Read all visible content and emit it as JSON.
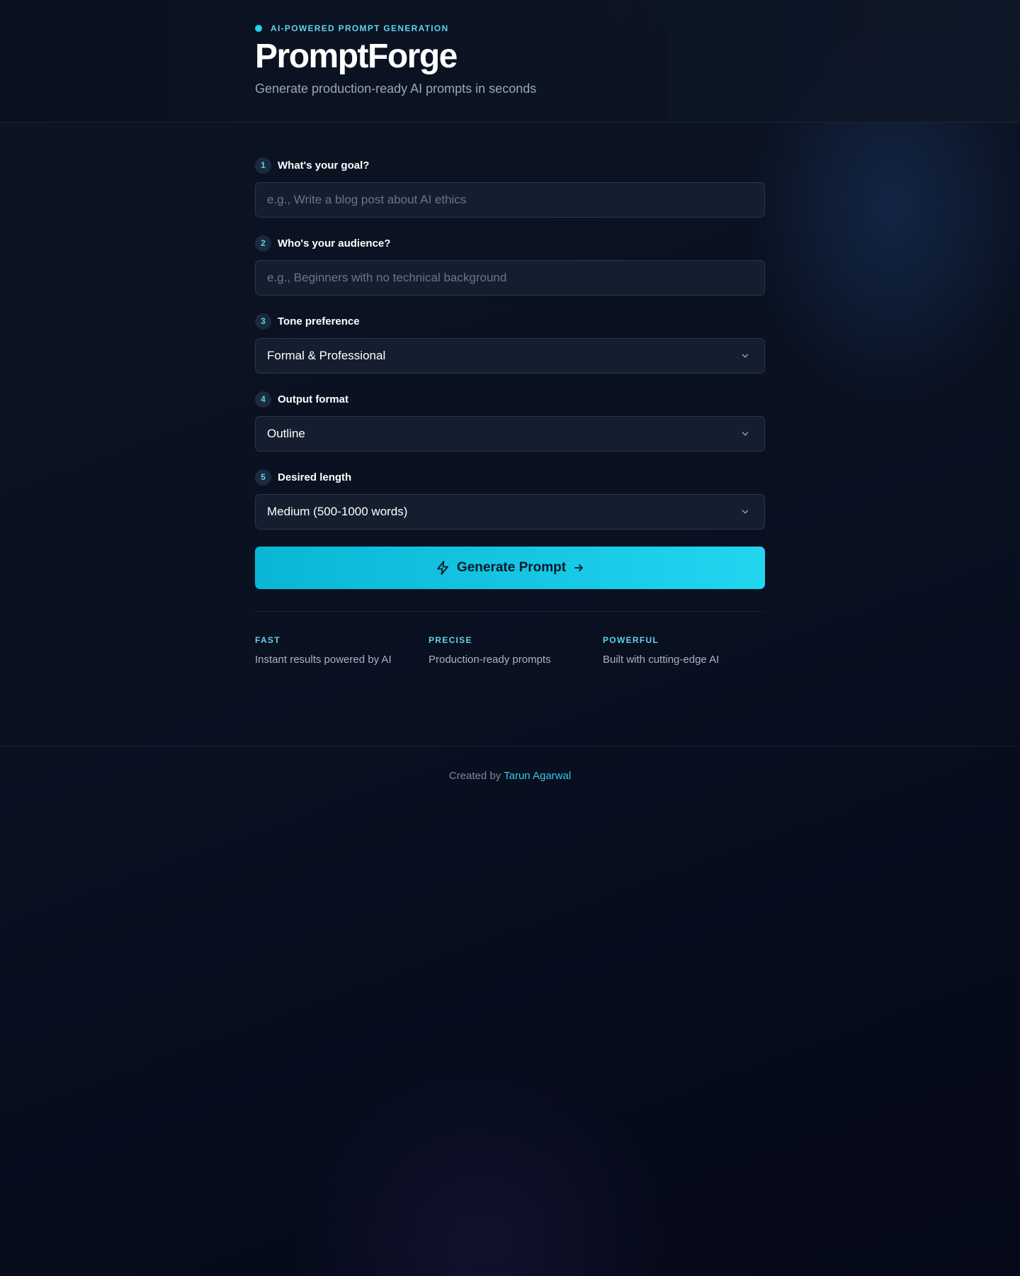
{
  "header": {
    "eyebrow": "AI-POWERED PROMPT GENERATION",
    "title": "PromptForge",
    "subtitle": "Generate production-ready AI prompts in seconds"
  },
  "form": {
    "fields": [
      {
        "step": "1",
        "label": "What's your goal?",
        "type": "input",
        "value": "",
        "placeholder": "e.g., Write a blog post about AI ethics"
      },
      {
        "step": "2",
        "label": "Who's your audience?",
        "type": "input",
        "value": "",
        "placeholder": "e.g., Beginners with no technical background"
      },
      {
        "step": "3",
        "label": "Tone preference",
        "type": "select",
        "value": "Formal & Professional"
      },
      {
        "step": "4",
        "label": "Output format",
        "type": "select",
        "value": "Outline"
      },
      {
        "step": "5",
        "label": "Desired length",
        "type": "select",
        "value": "Medium (500-1000 words)"
      }
    ],
    "submit_label": "Generate Prompt",
    "submit_icon": "lightning-icon",
    "submit_trailing_icon": "arrow-right-icon"
  },
  "features": [
    {
      "title": "FAST",
      "description": "Instant results powered by AI"
    },
    {
      "title": "PRECISE",
      "description": "Production-ready prompts"
    },
    {
      "title": "POWERFUL",
      "description": "Built with cutting-edge AI"
    }
  ],
  "footer": {
    "prefix": "Created by",
    "author": "Tarun Agarwal"
  },
  "colors": {
    "accent": "#22d3ee",
    "background": "#0a1222",
    "field_background": "#151e2e"
  }
}
